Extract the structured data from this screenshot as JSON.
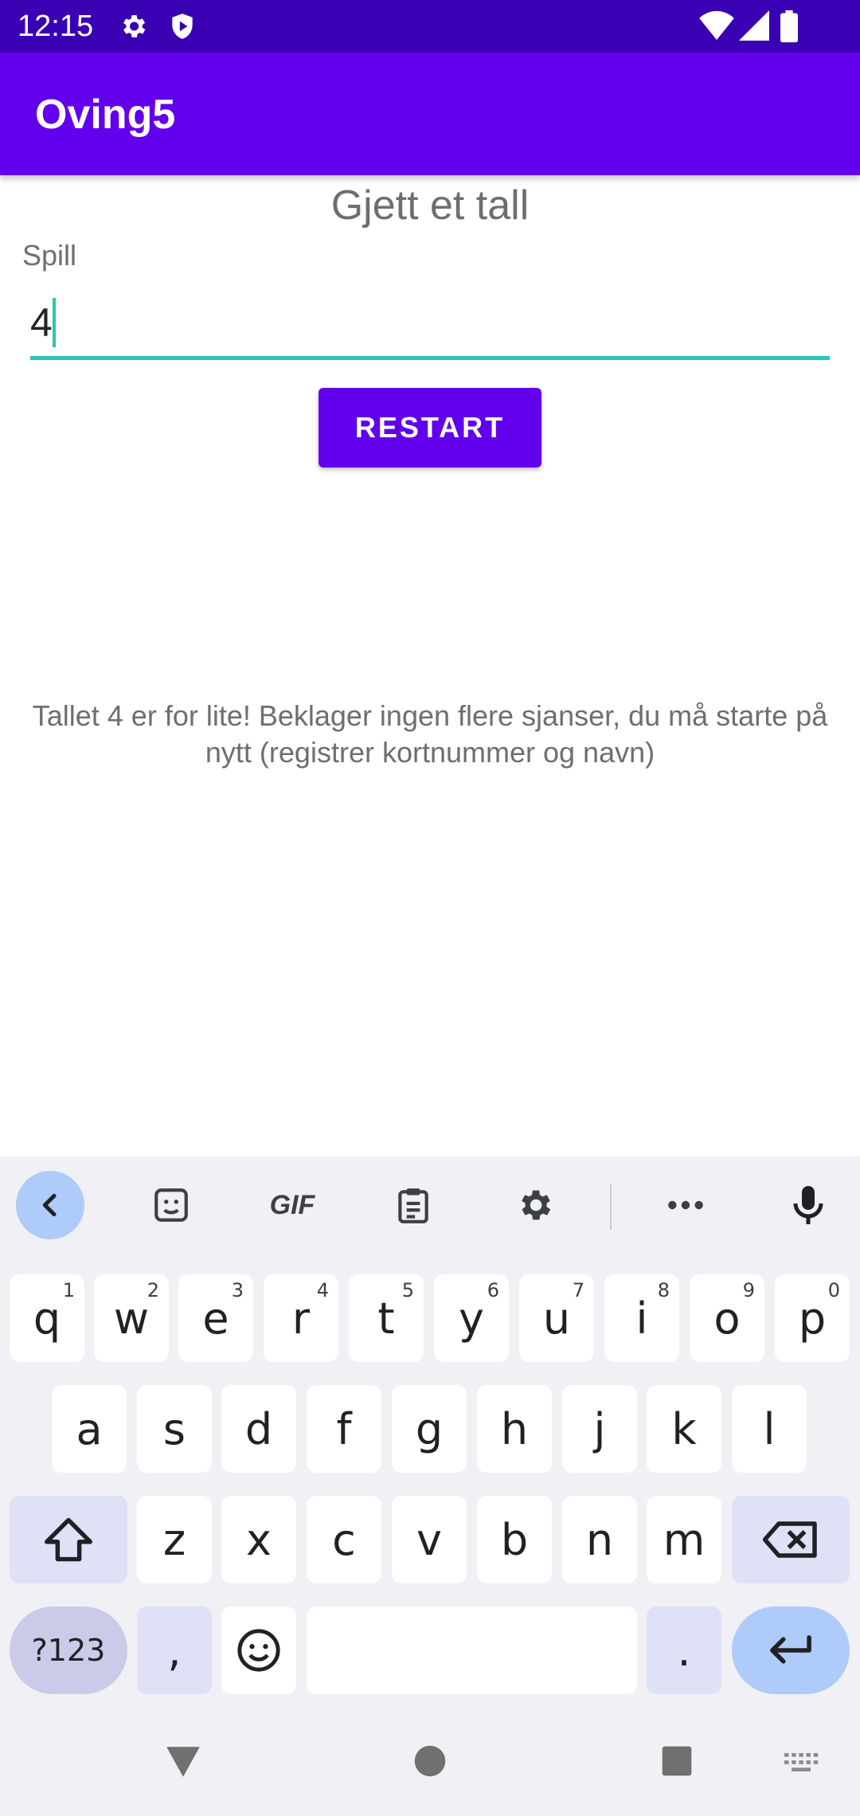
{
  "status_bar": {
    "time": "12:15",
    "icons_left": [
      "gear-icon",
      "shield-icon"
    ],
    "icons_right": [
      "wifi-icon",
      "signal-icon",
      "battery-icon"
    ]
  },
  "app_bar": {
    "title": "Oving5"
  },
  "colors": {
    "primary": "#6200ee",
    "primary_dark": "#3a00b4",
    "accent": "#26c6b4"
  },
  "main": {
    "heading": "Gjett et tall",
    "input_label": "Spill",
    "input_value": "4",
    "restart_label": "RESTART",
    "message": "Tallet 4 er for lite! Beklager ingen flere sjanser, du må starte på nytt (registrer kortnummer og navn)"
  },
  "keyboard": {
    "toolbar": [
      "back-icon",
      "sticker-icon",
      "gif-icon",
      "clipboard-icon",
      "settings-icon",
      "more-icon",
      "mic-icon"
    ],
    "gif_label": "GIF",
    "row1": [
      {
        "k": "q",
        "h": "1"
      },
      {
        "k": "w",
        "h": "2"
      },
      {
        "k": "e",
        "h": "3"
      },
      {
        "k": "r",
        "h": "4"
      },
      {
        "k": "t",
        "h": "5"
      },
      {
        "k": "y",
        "h": "6"
      },
      {
        "k": "u",
        "h": "7"
      },
      {
        "k": "i",
        "h": "8"
      },
      {
        "k": "o",
        "h": "9"
      },
      {
        "k": "p",
        "h": "0"
      }
    ],
    "row2": [
      "a",
      "s",
      "d",
      "f",
      "g",
      "h",
      "j",
      "k",
      "l"
    ],
    "row3": [
      "z",
      "x",
      "c",
      "v",
      "b",
      "n",
      "m"
    ],
    "sym_label": "?123",
    "comma": ",",
    "period": "."
  },
  "nav_bar": [
    "back-triangle-icon",
    "home-circle-icon",
    "recents-square-icon",
    "keyboard-switch-icon"
  ]
}
